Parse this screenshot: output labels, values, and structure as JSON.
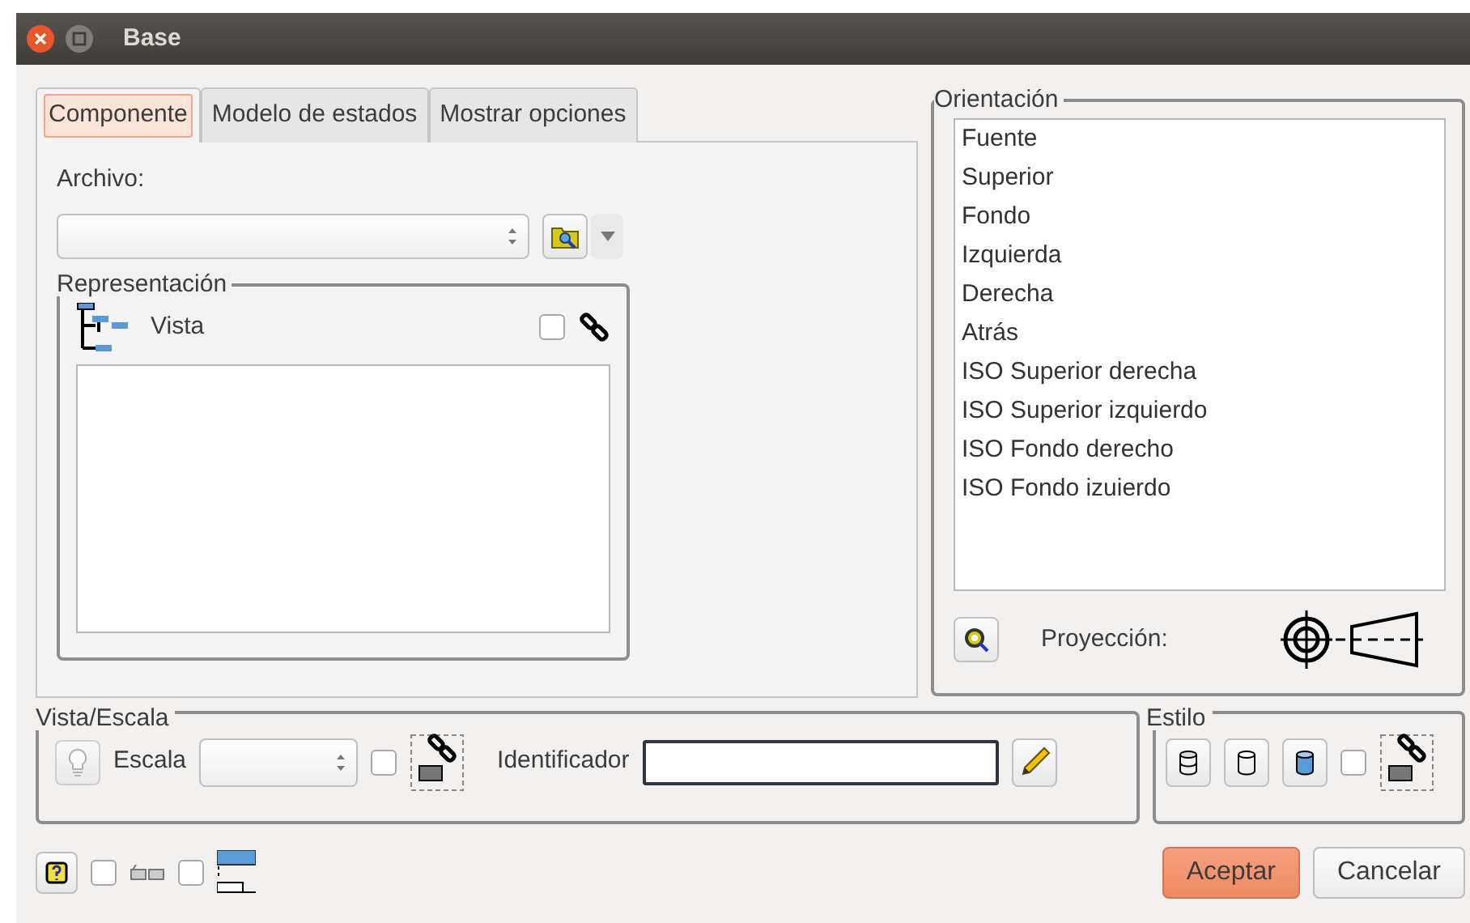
{
  "window": {
    "title": "Base"
  },
  "tabs": [
    {
      "label": "Componente",
      "selected": true
    },
    {
      "label": "Modelo de estados",
      "selected": false
    },
    {
      "label": "Mostrar opciones",
      "selected": false
    }
  ],
  "archivo": {
    "label": "Archivo:"
  },
  "representacion": {
    "title": "Representación",
    "item": "Vista",
    "checked": false
  },
  "orientacion": {
    "title": "Orientación",
    "items": [
      {
        "label": "Fuente",
        "selected": false
      },
      {
        "label": "Superior",
        "selected": false
      },
      {
        "label": "Fondo",
        "selected": false
      },
      {
        "label": "Izquierda",
        "selected": false
      },
      {
        "label": "Derecha",
        "selected": false
      },
      {
        "label": "Atrás",
        "selected": false
      },
      {
        "label": "ISO Superior derecha",
        "selected": false
      },
      {
        "label": "ISO Superior izquierdo",
        "selected": false
      },
      {
        "label": "ISO Fondo derecho",
        "selected": false
      },
      {
        "label": "ISO Fondo izuierdo",
        "selected": false
      }
    ],
    "projection_label": "Proyección:"
  },
  "vista_escala": {
    "title": "Vista/Escala",
    "escala_label": "Escala",
    "checked": false,
    "identificador_label": "Identificador"
  },
  "estilo": {
    "title": "Estilo",
    "checked": false
  },
  "bottom_checks": [
    {
      "checked": false
    },
    {
      "checked": false
    }
  ],
  "buttons": [
    {
      "label": "Aceptar",
      "kind": "primary"
    },
    {
      "label": "Cancelar",
      "kind": "default"
    }
  ]
}
